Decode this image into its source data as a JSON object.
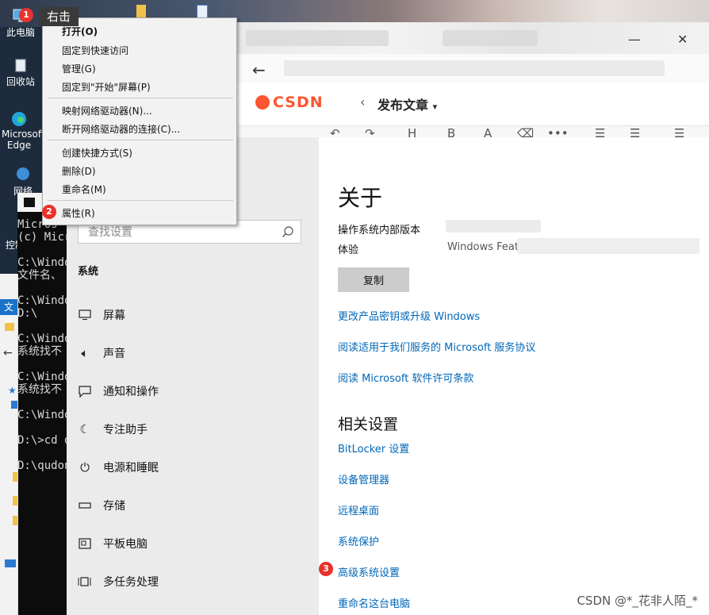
{
  "desktop": {
    "icons": [
      {
        "label": "此电脑"
      },
      {
        "label": "回收站"
      },
      {
        "label": "Microsoft"
      },
      {
        "label": "Edge"
      },
      {
        "label": "网络"
      },
      {
        "label": "控制"
      }
    ]
  },
  "terminal": {
    "lines": [
      "Micros",
      "(c) Micr",
      "C:\\Windo",
      "文件名、",
      "C:\\Windo",
      "D:\\",
      "C:\\Windo",
      "系统找不",
      "C:\\Windo",
      "系统找不",
      "C:\\Windo",
      "D:\\>cd d",
      "D:\\qudon"
    ]
  },
  "explorer": {
    "tab_label": "文件"
  },
  "browser": {
    "back_label": "←",
    "csdn_logo": "CSDN",
    "publish_label": "发布文章",
    "toolbar": [
      "↶",
      "↷",
      "H",
      "B",
      "A",
      "⌫",
      "•••",
      "☰",
      "☰",
      "☰"
    ],
    "window_controls": {
      "minimize": "—",
      "close": "✕"
    }
  },
  "settings": {
    "search_placeholder": "查找设置",
    "nav_section": "系统",
    "nav_items": [
      {
        "label": "屏幕",
        "icon": "monitor-icon"
      },
      {
        "label": "声音",
        "icon": "speaker-icon"
      },
      {
        "label": "通知和操作",
        "icon": "chat-icon"
      },
      {
        "label": "专注助手",
        "icon": "moon-icon"
      },
      {
        "label": "电源和睡眠",
        "icon": "power-icon"
      },
      {
        "label": "存储",
        "icon": "storage-icon"
      },
      {
        "label": "平板电脑",
        "icon": "tablet-icon"
      },
      {
        "label": "多任务处理",
        "icon": "multitask-icon"
      }
    ],
    "about_title": "关于",
    "os_build_label": "操作系统内部版本",
    "experience_label": "体验",
    "experience_value": "Windows Feat",
    "copy_button": "复制",
    "links": [
      "更改产品密钥或升级 Windows",
      "阅读适用于我们服务的 Microsoft 服务协议",
      "阅读 Microsoft 软件许可条款"
    ],
    "related_title": "相关设置",
    "related_links": [
      "BitLocker 设置",
      "设备管理器",
      "远程桌面",
      "系统保护",
      "高级系统设置",
      "重命名这台电脑"
    ]
  },
  "context_menu": {
    "items": [
      "打开(O)",
      "固定到快速访问",
      "管理(G)",
      "固定到\"开始\"屏幕(P)",
      "映射网络驱动器(N)...",
      "断开网络驱动器的连接(C)...",
      "创建快捷方式(S)",
      "删除(D)",
      "重命名(M)",
      "属性(R)"
    ]
  },
  "annotations": {
    "callout_text": "右击",
    "step1": "1",
    "step2": "2",
    "step3": "3",
    "badge_color": "#e8322b"
  },
  "watermark": "CSDN @*_花非人陌_*"
}
